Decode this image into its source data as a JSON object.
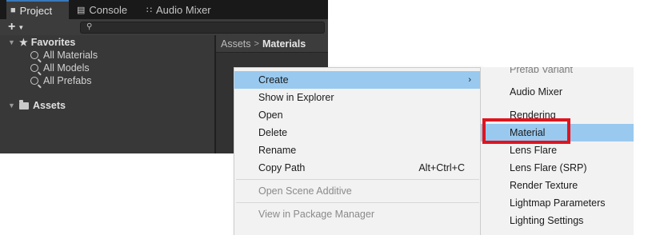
{
  "tabs": [
    {
      "label": "Project",
      "icon": "folder-icon",
      "active": true
    },
    {
      "label": "Console",
      "icon": "console-icon",
      "active": false
    },
    {
      "label": "Audio Mixer",
      "icon": "audio-mixer-icon",
      "active": false
    }
  ],
  "toolbar": {
    "create_label": "+",
    "search_placeholder": ""
  },
  "tree": {
    "favorites_label": "Favorites",
    "favorites": [
      "All Materials",
      "All Models",
      "All Prefabs"
    ],
    "assets_label": "Assets"
  },
  "breadcrumb": {
    "root": "Assets",
    "separator": ">",
    "current": "Materials"
  },
  "context_menu": {
    "items": [
      {
        "label": "Create",
        "highlighted": true,
        "has_submenu": true,
        "shortcut": ""
      },
      {
        "label": "Show in Explorer",
        "shortcut": ""
      },
      {
        "label": "Open",
        "shortcut": ""
      },
      {
        "label": "Delete",
        "shortcut": ""
      },
      {
        "label": "Rename",
        "shortcut": ""
      },
      {
        "label": "Copy Path",
        "shortcut": "Alt+Ctrl+C"
      },
      {
        "label": "Open Scene Additive",
        "disabled": true,
        "shortcut": ""
      },
      {
        "label": "View in Package Manager",
        "disabled": true,
        "shortcut": ""
      }
    ]
  },
  "submenu": {
    "items": [
      "Prefab Variant",
      "Audio Mixer",
      "Rendering",
      "Material",
      "Lens Flare",
      "Lens Flare (SRP)",
      "Render Texture",
      "Lightmap Parameters",
      "Lighting Settings"
    ],
    "highlighted": "Material"
  },
  "colors": {
    "highlight": "#99c9ef",
    "annotation": "#e0141e",
    "editor_bg": "#282828"
  }
}
